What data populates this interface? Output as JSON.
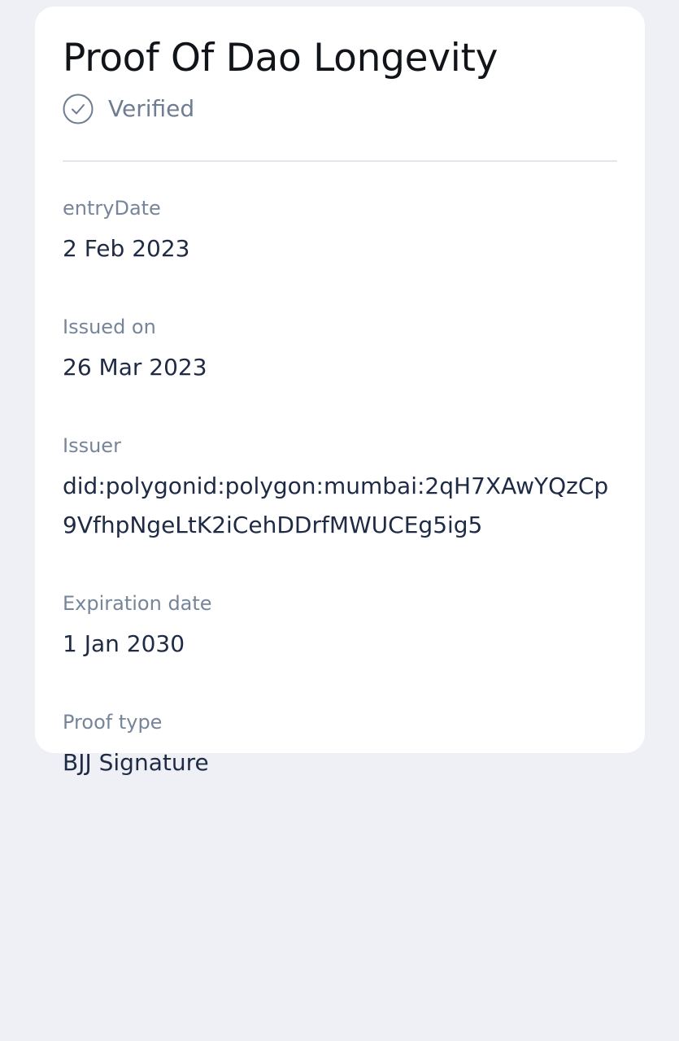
{
  "credential": {
    "title": "Proof Of Dao Longevity",
    "status": {
      "icon": "check-circle-icon",
      "label": "Verified"
    },
    "fields": [
      {
        "label": "entryDate",
        "value": "2 Feb 2023"
      },
      {
        "label": "Issued on",
        "value": "26 Mar 2023"
      },
      {
        "label": "Issuer",
        "value": "did:polygonid:polygon:mumbai:2qH7XAwYQzCp9VfhpNgeLtK2iCehDDrfMWUCEg5ig5"
      },
      {
        "label": "Expiration date",
        "value": "1 Jan 2030"
      },
      {
        "label": "Proof type",
        "value": "BJJ Signature"
      }
    ]
  },
  "colors": {
    "background": "#eef0f5",
    "card": "#ffffff",
    "title": "#111418",
    "muted": "#6f7c92",
    "value": "#1f2a44",
    "divider": "#e3e6ec"
  }
}
